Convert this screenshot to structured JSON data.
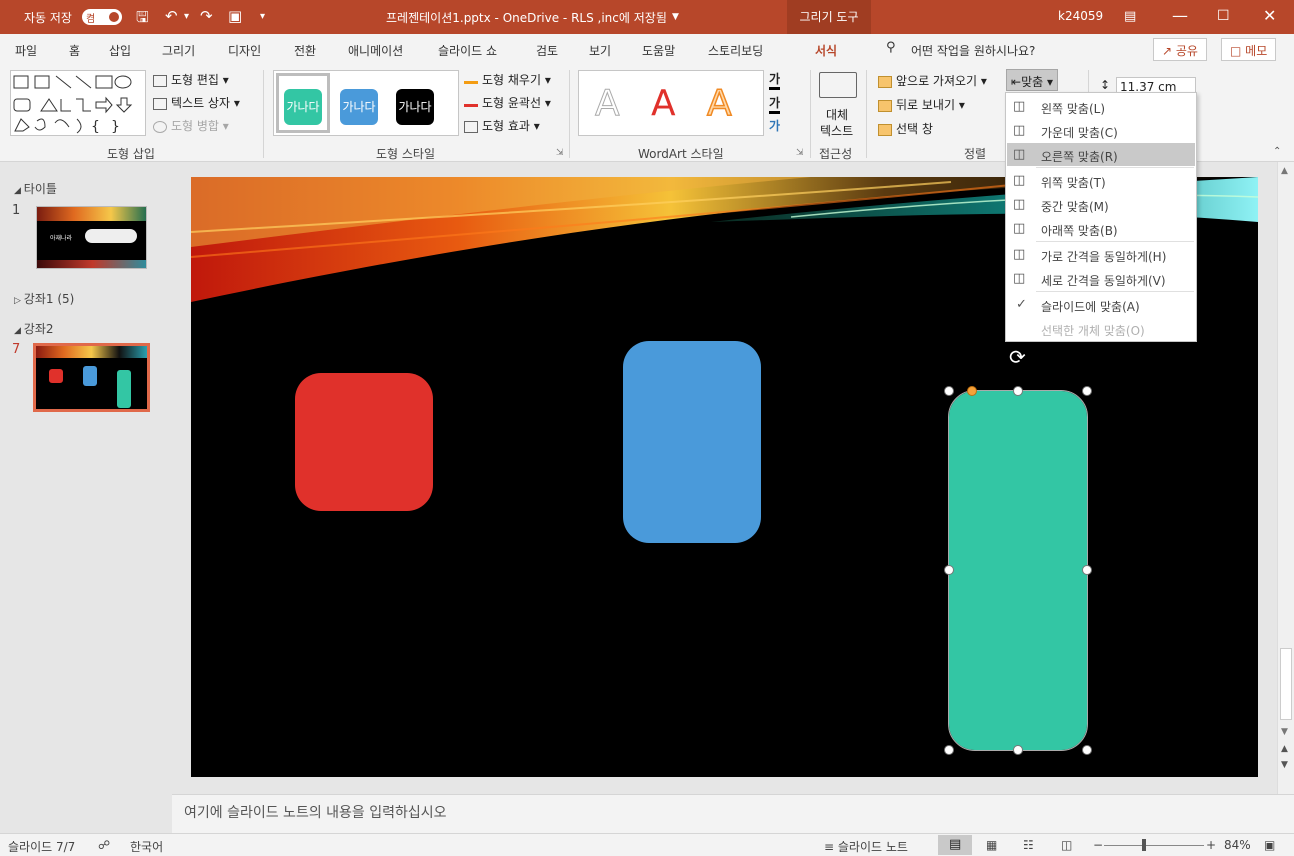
{
  "titlebar": {
    "autosave_label": "자동 저장",
    "autosave_state": "켬",
    "document_title": "프레젠테이션1.pptx - OneDrive - RLS ,inc에 저장됨",
    "contextual_tab": "그리기 도구",
    "user": "k24059"
  },
  "tabs": [
    "파일",
    "홈",
    "삽입",
    "그리기",
    "디자인",
    "전환",
    "애니메이션",
    "슬라이드 쇼",
    "검토",
    "보기",
    "도움말",
    "스토리보딩",
    "서식"
  ],
  "active_tab": "서식",
  "search_placeholder": "어떤 작업을 원하시나요?",
  "share_label": "공유",
  "memo_label": "메모",
  "ribbon": {
    "insert_shapes": {
      "label": "도형 삽입",
      "edit_shape": "도형 편집",
      "text_box": "텍스트 상자",
      "merge_shapes": "도형 병합"
    },
    "shape_styles": {
      "label": "도형 스타일",
      "sample_text": "가나다",
      "colors": [
        "#33c6a4",
        "#4a9ada",
        "#000000"
      ],
      "fill": "도형 채우기",
      "outline": "도형 윤곽선",
      "effects": "도형 효과"
    },
    "wordart": {
      "label": "WordArt 스타일",
      "letter": "A",
      "text_fill_glyph": "가"
    },
    "accessibility": {
      "label": "접근성",
      "alt_text_line1": "대체",
      "alt_text_line2": "텍스트"
    },
    "arrange": {
      "label": "정렬",
      "bring_forward": "앞으로 가져오기",
      "send_backward": "뒤로 보내기",
      "selection_pane": "선택 창",
      "align": "맞춤"
    },
    "size": {
      "height": "11.37 cm"
    }
  },
  "align_menu": [
    {
      "label": "왼쪽 맞춤(L)",
      "icon": "align-left-icon",
      "selected": false,
      "disabled": false
    },
    {
      "label": "가운데 맞춤(C)",
      "icon": "align-center-icon",
      "selected": false,
      "disabled": false
    },
    {
      "label": "오른쪽 맞춤(R)",
      "icon": "align-right-icon",
      "selected": true,
      "disabled": false
    },
    {
      "label": "위쪽 맞춤(T)",
      "icon": "align-top-icon",
      "selected": false,
      "disabled": false
    },
    {
      "label": "중간 맞춤(M)",
      "icon": "align-middle-icon",
      "selected": false,
      "disabled": false
    },
    {
      "label": "아래쪽 맞춤(B)",
      "icon": "align-bottom-icon",
      "selected": false,
      "disabled": false
    },
    {
      "label": "가로 간격을 동일하게(H)",
      "icon": "distribute-horizontal-icon",
      "selected": false,
      "disabled": false
    },
    {
      "label": "세로 간격을 동일하게(V)",
      "icon": "distribute-vertical-icon",
      "selected": false,
      "disabled": false
    },
    {
      "label": "슬라이드에 맞춤(A)",
      "icon": "check-icon",
      "selected": false,
      "disabled": false
    },
    {
      "label": "선택한 개체 맞춤(O)",
      "icon": "",
      "selected": false,
      "disabled": true
    }
  ],
  "slides_panel": {
    "section1": "타이틀",
    "slide1_number": "1",
    "slide1_text": "아재나라",
    "section2": "강좌1 (5)",
    "section3": "강좌2",
    "slide7_number": "7"
  },
  "slide": {
    "shapes": [
      {
        "name": "red-rounded-rect",
        "color": "#e0312b"
      },
      {
        "name": "blue-rounded-rect",
        "color": "#4a9ada"
      },
      {
        "name": "green-rounded-rect",
        "color": "#33c6a4"
      }
    ]
  },
  "notes_placeholder": "여기에 슬라이드 노트의 내용을 입력하십시오",
  "statusbar": {
    "slide_counter": "슬라이드 7/7",
    "language": "한국어",
    "notes_button": "슬라이드 노트",
    "zoom": "84%"
  }
}
